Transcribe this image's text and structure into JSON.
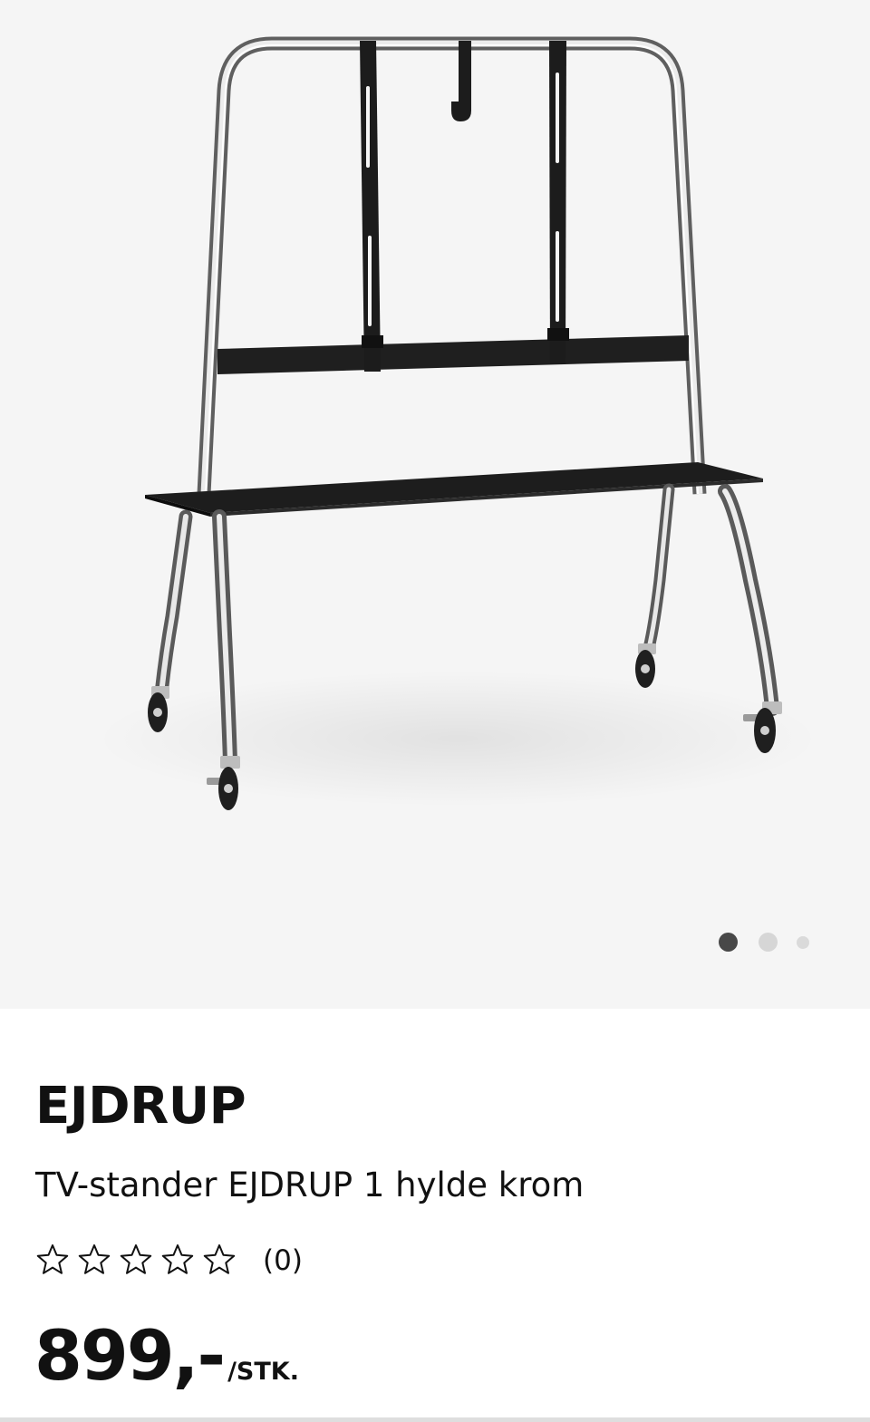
{
  "gallery": {
    "image_alt": "TV-stander EJDRUP 1 hylde krom",
    "active_index": 1,
    "total": 3
  },
  "product": {
    "name": "EJDRUP",
    "description": "TV-stander EJDRUP 1 hylde krom",
    "rating": {
      "stars_filled": 0,
      "stars_total": 5,
      "count_label": "(0)"
    },
    "price": {
      "amount": "899,-",
      "unit": "/STK."
    }
  },
  "colors": {
    "gallery_bg": "#f5f5f5",
    "dot_active": "#484848",
    "dot_inactive": "#d6d6d6",
    "text": "#111111"
  }
}
